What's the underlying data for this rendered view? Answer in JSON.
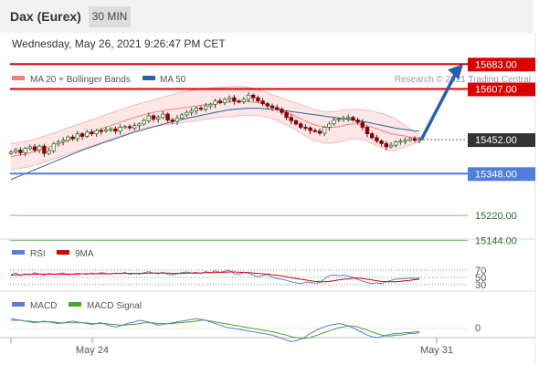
{
  "header": {
    "title": "Dax (Eurex)",
    "timeframe": "30 MIN"
  },
  "date_line": "Wednesday, May 26, 2021 9:26:47 PM CET",
  "legend": {
    "ma20": "MA 20 + Bollinger Bands",
    "ma50": "MA 50",
    "credit": "Research © 2021 Trading Central"
  },
  "colors": {
    "resistance": "#d90000",
    "support": "#4f7fd9",
    "target": "#78b878",
    "ma20": "#f08080",
    "ma50": "#2f5f9f",
    "candle_up": "#3a7a2a",
    "candle_down": "#8b0000",
    "arrow": "#2b5ea8"
  },
  "chart_data": [
    {
      "type": "candlestick",
      "title": "Dax (Eurex) 30 MIN",
      "ylim": [
        15120,
        15720
      ],
      "x_labels": [
        "May 24",
        "May 31"
      ],
      "price_levels": [
        {
          "label": "15683.00",
          "value": 15683,
          "kind": "resistance"
        },
        {
          "label": "15607.00",
          "value": 15607,
          "kind": "resistance"
        },
        {
          "label": "15452.00",
          "value": 15452,
          "kind": "current"
        },
        {
          "label": "15348.00",
          "value": 15348,
          "kind": "support"
        },
        {
          "label": "15220.00",
          "value": 15220,
          "kind": "target"
        },
        {
          "label": "15144.00",
          "value": 15144,
          "kind": "target"
        }
      ],
      "close": [
        15415,
        15420,
        15412,
        15425,
        15430,
        15420,
        15432,
        15410,
        15418,
        15440,
        15445,
        15450,
        15460,
        15455,
        15470,
        15462,
        15475,
        15470,
        15480,
        15478,
        15482,
        15485,
        15478,
        15490,
        15492,
        15488,
        15495,
        15500,
        15510,
        15525,
        15515,
        15520,
        15530,
        15512,
        15508,
        15518,
        15528,
        15535,
        15540,
        15548,
        15545,
        15555,
        15560,
        15570,
        15565,
        15575,
        15580,
        15570,
        15568,
        15575,
        15588,
        15580,
        15570,
        15562,
        15555,
        15550,
        15545,
        15535,
        15520,
        15510,
        15500,
        15490,
        15488,
        15480,
        15478,
        15472,
        15490,
        15500,
        15512,
        15515,
        15518,
        15520,
        15512,
        15505,
        15490,
        15470,
        15458,
        15448,
        15440,
        15430,
        15435,
        15445,
        15448,
        15450,
        15455,
        15450,
        15452
      ],
      "ma20": [
        15400,
        15403,
        15405,
        15408,
        15412,
        15415,
        15420,
        15425,
        15430,
        15435,
        15440,
        15445,
        15450,
        15455,
        15460,
        15465,
        15470,
        15475,
        15480,
        15485,
        15490,
        15495,
        15500,
        15505,
        15510,
        15515,
        15520,
        15524,
        15528,
        15532,
        15535,
        15538,
        15540,
        15543,
        15545,
        15547,
        15549,
        15551,
        15553,
        15555,
        15557,
        15559,
        15561,
        15563,
        15565,
        15567,
        15568,
        15569,
        15570,
        15570,
        15569,
        15567,
        15565,
        15562,
        15558,
        15553,
        15548,
        15542,
        15536,
        15530,
        15523,
        15516,
        15509,
        15502,
        15497,
        15493,
        15490,
        15489,
        15490,
        15492,
        15495,
        15498,
        15500,
        15500,
        15498,
        15495,
        15490,
        15485,
        15480,
        15475,
        15470,
        15467,
        15465,
        15463,
        15460,
        15458,
        15456
      ],
      "bb_upper": [
        15440,
        15442,
        15444,
        15447,
        15450,
        15454,
        15458,
        15463,
        15468,
        15473,
        15478,
        15483,
        15488,
        15493,
        15498,
        15503,
        15508,
        15513,
        15518,
        15523,
        15528,
        15533,
        15538,
        15543,
        15548,
        15553,
        15558,
        15562,
        15566,
        15570,
        15574,
        15578,
        15582,
        15586,
        15590,
        15594,
        15598,
        15600,
        15602,
        15604,
        15606,
        15608,
        15610,
        15611,
        15612,
        15613,
        15614,
        15615,
        15615,
        15614,
        15612,
        15609,
        15605,
        15600,
        15595,
        15590,
        15585,
        15580,
        15575,
        15570,
        15565,
        15560,
        15555,
        15550,
        15545,
        15540,
        15538,
        15537,
        15538,
        15540,
        15542,
        15544,
        15545,
        15545,
        15544,
        15542,
        15540,
        15536,
        15532,
        15528,
        15522,
        15515,
        15505,
        15495,
        15485,
        15475,
        15468
      ],
      "bb_lower": [
        15360,
        15362,
        15364,
        15367,
        15370,
        15374,
        15378,
        15383,
        15388,
        15393,
        15398,
        15403,
        15408,
        15413,
        15418,
        15423,
        15428,
        15433,
        15438,
        15443,
        15448,
        15453,
        15458,
        15463,
        15468,
        15473,
        15478,
        15482,
        15486,
        15490,
        15492,
        15494,
        15496,
        15498,
        15500,
        15502,
        15504,
        15506,
        15508,
        15510,
        15512,
        15514,
        15516,
        15518,
        15520,
        15522,
        15522,
        15523,
        15525,
        15526,
        15526,
        15525,
        15525,
        15524,
        15520,
        15516,
        15511,
        15504,
        15497,
        15490,
        15481,
        15472,
        15463,
        15454,
        15449,
        15446,
        15442,
        15441,
        15442,
        15444,
        15448,
        15452,
        15455,
        15455,
        15452,
        15448,
        15440,
        15434,
        15428,
        15422,
        15418,
        15419,
        15425,
        15431,
        15435,
        15441,
        15444
      ],
      "ma50": [
        15330,
        15336,
        15342,
        15348,
        15354,
        15360,
        15366,
        15372,
        15378,
        15384,
        15390,
        15396,
        15402,
        15408,
        15414,
        15420,
        15425,
        15430,
        15435,
        15440,
        15445,
        15450,
        15455,
        15460,
        15465,
        15470,
        15475,
        15479,
        15483,
        15487,
        15491,
        15495,
        15499,
        15503,
        15507,
        15511,
        15514,
        15517,
        15520,
        15523,
        15526,
        15529,
        15532,
        15535,
        15538,
        15541,
        15543,
        15545,
        15546,
        15547,
        15548,
        15548,
        15548,
        15547,
        15546,
        15545,
        15544,
        15542,
        15540,
        15538,
        15536,
        15534,
        15532,
        15530,
        15528,
        15526,
        15524,
        15522,
        15520,
        15518,
        15516,
        15514,
        15512,
        15510,
        15508,
        15505,
        15502,
        15499,
        15496,
        15493,
        15490,
        15487,
        15485,
        15483,
        15481,
        15479,
        15478
      ]
    },
    {
      "type": "line",
      "title": "RSI",
      "series": [
        {
          "name": "RSI"
        },
        {
          "name": "9MA"
        }
      ],
      "levels": [
        {
          "label": "70",
          "value": 70
        },
        {
          "label": "50",
          "value": 50
        },
        {
          "label": "30",
          "value": 30
        }
      ],
      "ylim": [
        20,
        80
      ],
      "rsi": [
        58,
        62,
        55,
        60,
        57,
        63,
        59,
        56,
        61,
        58,
        60,
        62,
        57,
        59,
        61,
        60,
        58,
        62,
        60,
        63,
        61,
        59,
        62,
        60,
        64,
        58,
        61,
        59,
        63,
        66,
        62,
        60,
        64,
        58,
        57,
        60,
        63,
        65,
        62,
        64,
        61,
        66,
        63,
        68,
        64,
        67,
        70,
        60,
        58,
        64,
        62,
        56,
        52,
        55,
        58,
        50,
        47,
        45,
        42,
        38,
        35,
        33,
        37,
        36,
        34,
        36,
        46,
        55,
        57,
        55,
        56,
        54,
        50,
        44,
        40,
        36,
        33,
        35,
        33,
        38,
        42,
        45,
        46,
        47,
        48,
        47,
        48
      ],
      "ma9": [
        56,
        57,
        57,
        58,
        58,
        59,
        59,
        59,
        59,
        59,
        59,
        59,
        59,
        59,
        59,
        60,
        60,
        60,
        60,
        60,
        60,
        60,
        61,
        61,
        61,
        61,
        61,
        61,
        61,
        62,
        62,
        62,
        62,
        62,
        61,
        61,
        61,
        62,
        62,
        62,
        62,
        63,
        63,
        63,
        64,
        64,
        65,
        65,
        64,
        64,
        63,
        62,
        61,
        60,
        59,
        57,
        56,
        54,
        52,
        49,
        47,
        45,
        43,
        41,
        39,
        38,
        38,
        39,
        41,
        43,
        45,
        46,
        48,
        48,
        47,
        45,
        43,
        41,
        39,
        38,
        38,
        38,
        39,
        41,
        42,
        44,
        45
      ]
    },
    {
      "type": "line",
      "title": "MACD",
      "series": [
        {
          "name": "MACD"
        },
        {
          "name": "MACD Signal"
        }
      ],
      "levels": [
        {
          "label": "0",
          "value": 0
        }
      ],
      "ylim": [
        -30,
        30
      ],
      "macd": [
        12,
        11,
        10,
        9,
        8,
        7,
        8,
        9,
        8,
        7,
        6,
        7,
        8,
        9,
        8,
        7,
        6,
        5,
        6,
        7,
        5,
        3,
        2,
        3,
        5,
        7,
        8,
        10,
        9,
        8,
        6,
        4,
        5,
        6,
        7,
        8,
        9,
        10,
        11,
        12,
        11,
        10,
        8,
        6,
        4,
        2,
        1,
        0,
        -1,
        -2,
        -3,
        -4,
        -5,
        -6,
        -7,
        -8,
        -10,
        -12,
        -14,
        -16,
        -15,
        -13,
        -10,
        -6,
        -3,
        0,
        2,
        4,
        5,
        6,
        5,
        3,
        1,
        -2,
        -5,
        -8,
        -10,
        -11,
        -10,
        -8,
        -7,
        -6,
        -6,
        -5,
        -5,
        -4,
        -4
      ],
      "signal": [
        10,
        10,
        10,
        9,
        9,
        8,
        8,
        8,
        8,
        8,
        7,
        7,
        7,
        7,
        7,
        7,
        7,
        6,
        6,
        6,
        6,
        5,
        5,
        4,
        4,
        5,
        5,
        6,
        7,
        7,
        7,
        6,
        6,
        6,
        6,
        7,
        7,
        8,
        8,
        9,
        10,
        10,
        9,
        8,
        7,
        6,
        5,
        4,
        3,
        2,
        1,
        0,
        -1,
        -2,
        -3,
        -4,
        -5,
        -7,
        -8,
        -10,
        -11,
        -12,
        -12,
        -11,
        -9,
        -7,
        -5,
        -3,
        -1,
        1,
        2,
        3,
        3,
        2,
        0,
        -2,
        -4,
        -6,
        -8,
        -9,
        -9,
        -8,
        -8,
        -7,
        -6,
        -6,
        -5
      ]
    }
  ],
  "rsi_legend": {
    "rsi": "RSI",
    "ma9": "9MA"
  },
  "macd_legend": {
    "macd": "MACD",
    "signal": "MACD Signal"
  }
}
